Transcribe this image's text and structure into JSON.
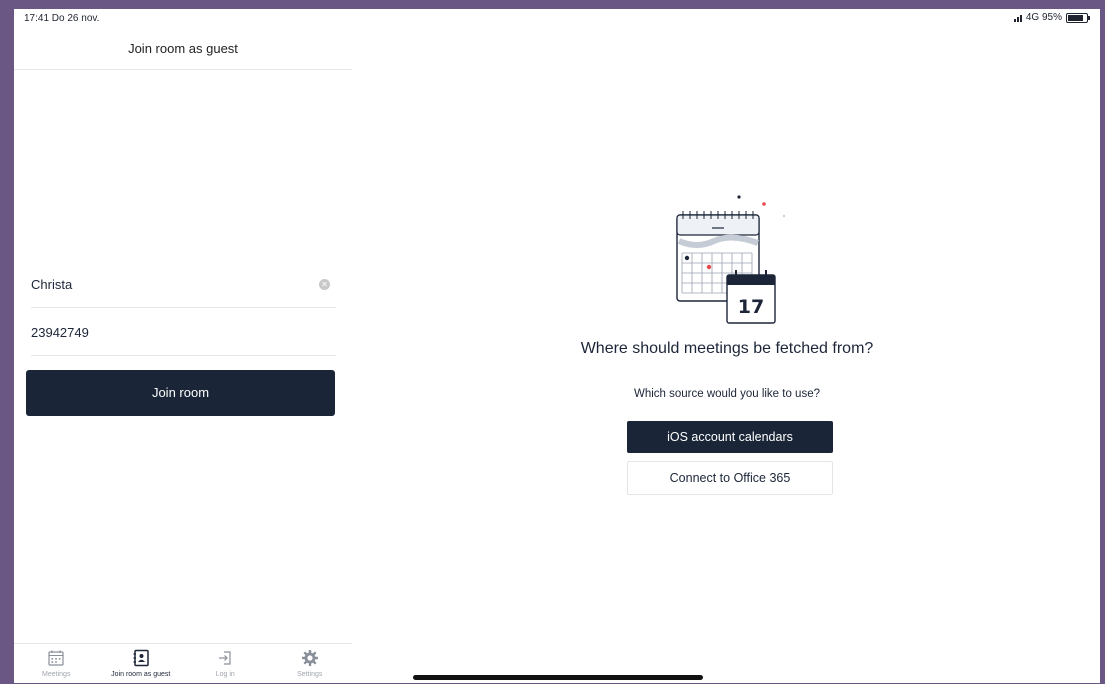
{
  "status_bar": {
    "time_date": "17:41  Do 26 nov.",
    "network": "4G 95%"
  },
  "sidebar": {
    "title": "Join room as guest",
    "name_field": {
      "value": "Christa"
    },
    "room_field": {
      "value": "23942749"
    },
    "join_button_label": "Join room"
  },
  "tabbar": {
    "tabs": [
      {
        "label": "Meetings",
        "icon": "calendar-icon"
      },
      {
        "label": "Join room as guest",
        "icon": "contact-card-icon",
        "active": true
      },
      {
        "label": "Log in",
        "icon": "login-icon"
      },
      {
        "label": "Settings",
        "icon": "gear-icon"
      }
    ]
  },
  "main": {
    "illustration": {
      "icon": "calendar-illustration",
      "day_number": "17"
    },
    "title": "Where should meetings be fetched from?",
    "subtitle": "Which source would you like to use?",
    "buttons": {
      "ios_calendars": "iOS account calendars",
      "office365": "Connect to Office 365"
    }
  },
  "colors": {
    "primary": "#1a2638",
    "frame": "#6b5784",
    "accent_red": "#e84a4a"
  }
}
